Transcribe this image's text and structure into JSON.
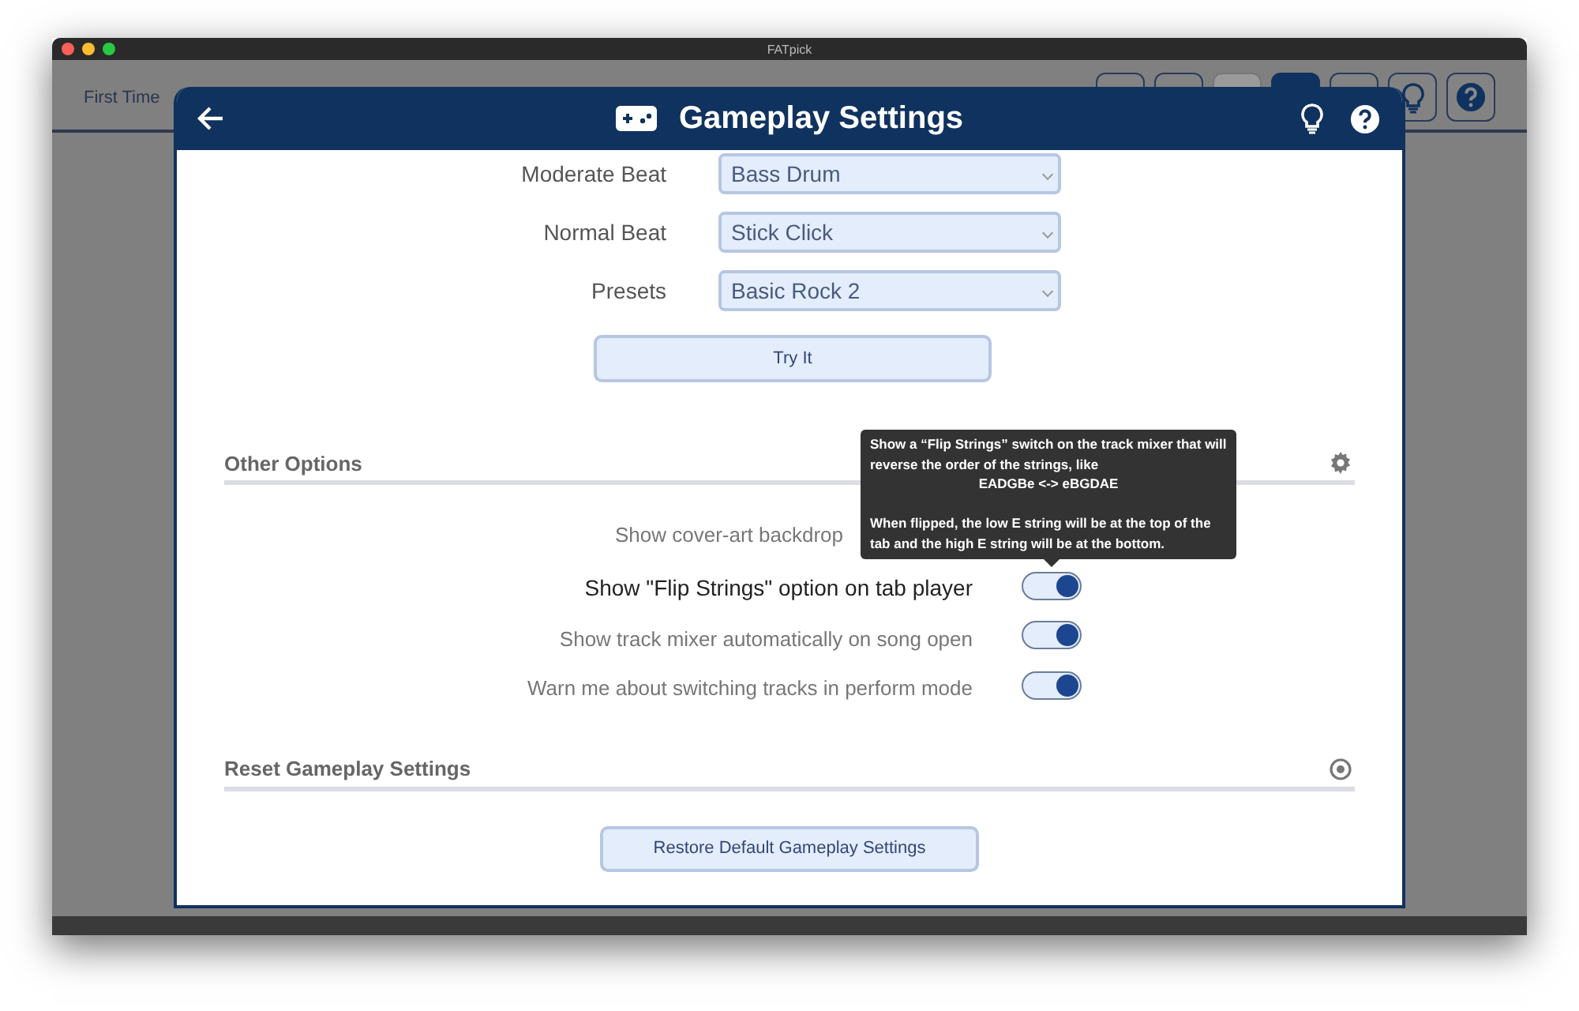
{
  "window": {
    "title": "FATpick"
  },
  "background": {
    "heading": "First Time",
    "toolbar_buttons": [
      {
        "selected": false,
        "disabled": false
      },
      {
        "selected": false,
        "disabled": false
      },
      {
        "selected": false,
        "disabled": true
      },
      {
        "selected": true,
        "disabled": false
      },
      {
        "selected": false,
        "disabled": false
      },
      {
        "selected": false,
        "disabled": false
      },
      {
        "selected": false,
        "disabled": false
      }
    ]
  },
  "dialog": {
    "title": "Gameplay Settings",
    "select_rows": [
      {
        "label": "Moderate Beat",
        "value": "Bass Drum"
      },
      {
        "label": "Normal Beat",
        "value": "Stick Click"
      },
      {
        "label": "Presets",
        "value": "Basic Rock 2"
      }
    ],
    "try_button": "Try It",
    "sections": [
      {
        "title": "Other Options",
        "kind": "options",
        "rows": [
          {
            "label": "Show cover-art backdrop",
            "highlighted": false
          },
          {
            "label": "Show \"Flip Strings\" option on tab player",
            "on": true,
            "highlighted": true
          },
          {
            "label": "Show track mixer automatically on song open",
            "on": true,
            "highlighted": false
          },
          {
            "label": "Warn me about switching tracks in perform mode",
            "on": true,
            "highlighted": false
          }
        ]
      },
      {
        "title": "Reset Gameplay Settings",
        "kind": "reset",
        "button": "Restore Default Gameplay Settings"
      }
    ],
    "tooltip": {
      "intro": "Show a “Flip Strings” switch on the track mixer that will reverse the order of the strings, like",
      "example": "EADGBe <-> eBGDAE",
      "note": "When flipped, the low E string will be at the top of the tab and the high E string will be at the bottom."
    }
  }
}
